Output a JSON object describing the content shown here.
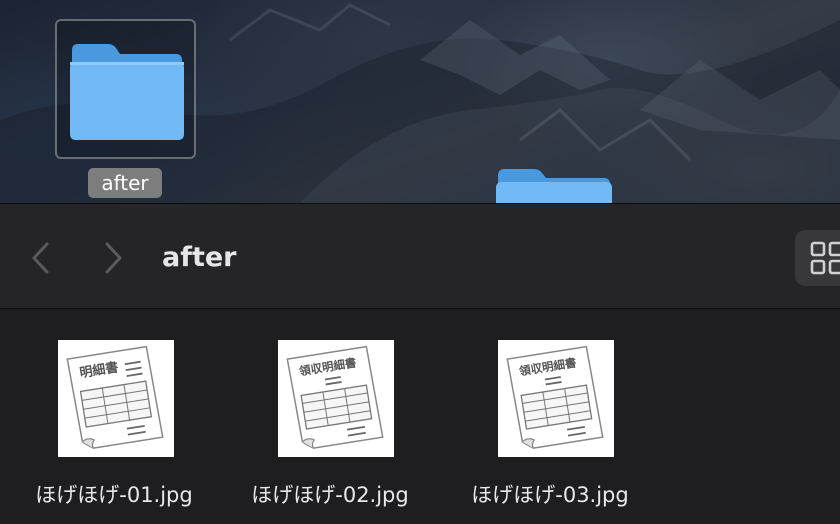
{
  "desktop": {
    "folder_label": "after",
    "folder_icon": "folder-icon"
  },
  "window": {
    "title": "after",
    "back_icon": "chevron-left-icon",
    "forward_icon": "chevron-right-icon",
    "view_icon": "grid-view-icon"
  },
  "files": [
    {
      "name": "ほげほげ-01.jpg",
      "thumbnail_title": "明細書"
    },
    {
      "name": "ほげほげ-02.jpg",
      "thumbnail_title": "領収明細書"
    },
    {
      "name": "ほげほげ-03.jpg",
      "thumbnail_title": "領収明細書"
    }
  ],
  "colors": {
    "folder_blue": "#6fb5f2",
    "window_bg": "#1e1e20",
    "toolbar_bg": "#252527"
  }
}
